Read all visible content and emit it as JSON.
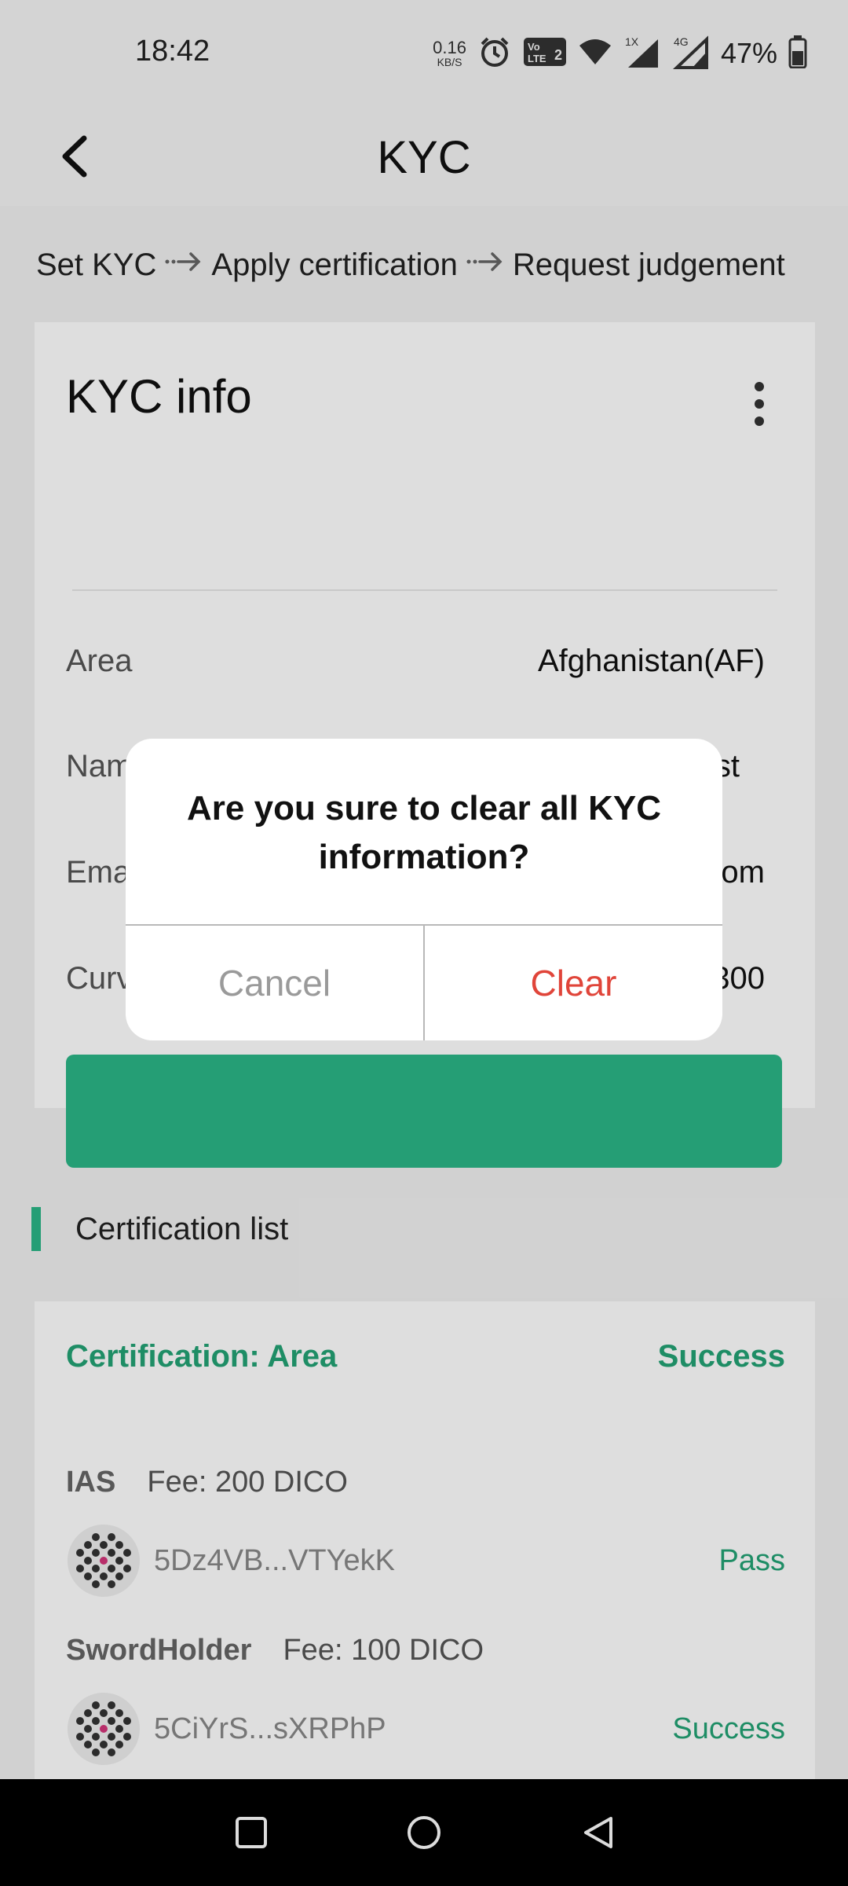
{
  "status_bar": {
    "time": "18:42",
    "net_speed_value": "0.16",
    "net_speed_unit": "KB/S",
    "volte_badge": "Vo LTE2",
    "signal1_tag": "1X",
    "signal2_tag": "4G",
    "battery_percent": "47%",
    "icons": [
      "alarm-icon",
      "volte-icon",
      "wifi-icon",
      "signal-icon",
      "signal-icon",
      "battery-icon"
    ]
  },
  "app_bar": {
    "title": "KYC",
    "back_icon": "chevron-left-icon"
  },
  "steps": {
    "items": [
      "Set KYC",
      "Apply certification",
      "Request judgement"
    ],
    "separator": "··→"
  },
  "kyc_info": {
    "title": "KYC info",
    "menu_icon": "more-vertical-icon",
    "rows": [
      {
        "label": "Area",
        "value": "Afghanistan(AF)"
      },
      {
        "label": "Name",
        "value": "Test"
      },
      {
        "label": "Ema",
        "value": "om"
      },
      {
        "label": "Curv",
        "value": "300"
      }
    ],
    "primary_color": "#2bb687"
  },
  "certification_list": {
    "title": "Certification list",
    "card": {
      "title": "Certification: Area",
      "status": "Success",
      "registrars": [
        {
          "name": "IAS",
          "fee": "Fee: 200 DICO",
          "address": "5Dz4VB...VTYekK",
          "judgement": "Pass"
        },
        {
          "name": "SwordHolder",
          "fee": "Fee: 100 DICO",
          "address": "5CiYrS...sXRPhP",
          "judgement": "Success"
        }
      ]
    }
  },
  "dialog": {
    "message": "Are you sure to clear all KYC information?",
    "cancel_label": "Cancel",
    "clear_label": "Clear",
    "clear_color": "#e0453a"
  },
  "nav_bar": {
    "icons": [
      "recent-apps-icon",
      "home-icon",
      "back-icon"
    ]
  }
}
